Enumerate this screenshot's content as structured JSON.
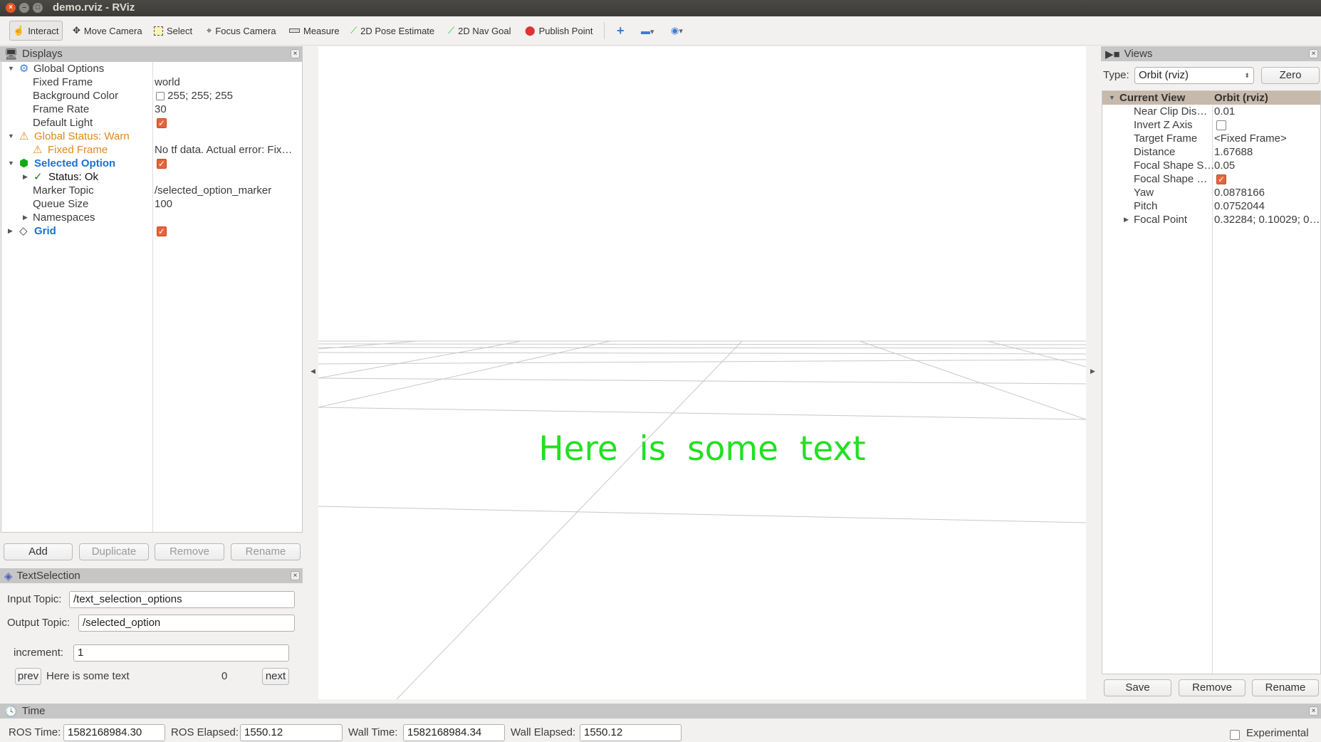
{
  "window": {
    "title": "demo.rviz - RViz"
  },
  "toolbar": {
    "tools": [
      {
        "label": "Interact",
        "icon": "hand-icon",
        "active": true
      },
      {
        "label": "Move Camera",
        "icon": "move-camera-icon"
      },
      {
        "label": "Select",
        "icon": "select-icon"
      },
      {
        "label": "Focus Camera",
        "icon": "focus-camera-icon"
      },
      {
        "label": "Measure",
        "icon": "ruler-icon"
      },
      {
        "label": "2D Pose Estimate",
        "icon": "green-arrow-icon"
      },
      {
        "label": "2D Nav Goal",
        "icon": "green-arrow-icon"
      },
      {
        "label": "Publish Point",
        "icon": "map-pin-icon"
      }
    ]
  },
  "displays": {
    "title": "Displays",
    "rows": [
      {
        "key": "Global Options",
        "value": ""
      },
      {
        "key": "Fixed Frame",
        "value": "world"
      },
      {
        "key": "Background Color",
        "value": "255; 255; 255"
      },
      {
        "key": "Frame Rate",
        "value": "30"
      },
      {
        "key": "Default Light",
        "value": ""
      },
      {
        "key": "Global Status: Warn",
        "value": ""
      },
      {
        "key": "Fixed Frame",
        "value": "No tf data.  Actual error: Fix…"
      },
      {
        "key": "Selected Option",
        "value": ""
      },
      {
        "key": "Status: Ok",
        "value": ""
      },
      {
        "key": "Marker Topic",
        "value": "/selected_option_marker"
      },
      {
        "key": "Queue Size",
        "value": "100"
      },
      {
        "key": "Namespaces",
        "value": ""
      },
      {
        "key": "Grid",
        "value": ""
      }
    ],
    "buttons": {
      "add": "Add",
      "duplicate": "Duplicate",
      "remove": "Remove",
      "rename": "Rename"
    }
  },
  "text_selection": {
    "title": "TextSelection",
    "input_topic_label": "Input Topic:",
    "input_topic": "/text_selection_options",
    "output_topic_label": "Output Topic:",
    "output_topic": "/selected_option",
    "increment_label": "increment:",
    "increment": "1",
    "prev": "prev",
    "current_text": "Here is some text",
    "index": "0",
    "next": "next"
  },
  "viewport": {
    "marker_text": "Here  is  some  text",
    "marker_color": "#22e022"
  },
  "views": {
    "title": "Views",
    "type_label": "Type:",
    "type_value": "Orbit (rviz)",
    "zero": "Zero",
    "header_key": "Current View",
    "header_value": "Orbit (rviz)",
    "rows": [
      {
        "key": "Near Clip Dis…",
        "value": "0.01"
      },
      {
        "key": "Invert Z Axis",
        "value": ""
      },
      {
        "key": "Target Frame",
        "value": "<Fixed Frame>"
      },
      {
        "key": "Distance",
        "value": "1.67688"
      },
      {
        "key": "Focal Shape S…",
        "value": "0.05"
      },
      {
        "key": "Focal Shape …",
        "value": ""
      },
      {
        "key": "Yaw",
        "value": "0.0878166"
      },
      {
        "key": "Pitch",
        "value": "0.0752044"
      },
      {
        "key": "Focal Point",
        "value": "0.32284; 0.10029; 0…"
      }
    ],
    "buttons": {
      "save": "Save",
      "remove": "Remove",
      "rename": "Rename"
    }
  },
  "time": {
    "title": "Time",
    "ros_time_label": "ROS Time:",
    "ros_time": "1582168984.30",
    "ros_elapsed_label": "ROS Elapsed:",
    "ros_elapsed": "1550.12",
    "wall_time_label": "Wall Time:",
    "wall_time": "1582168984.34",
    "wall_elapsed_label": "Wall Elapsed:",
    "wall_elapsed": "1550.12",
    "experimental": "Experimental"
  }
}
